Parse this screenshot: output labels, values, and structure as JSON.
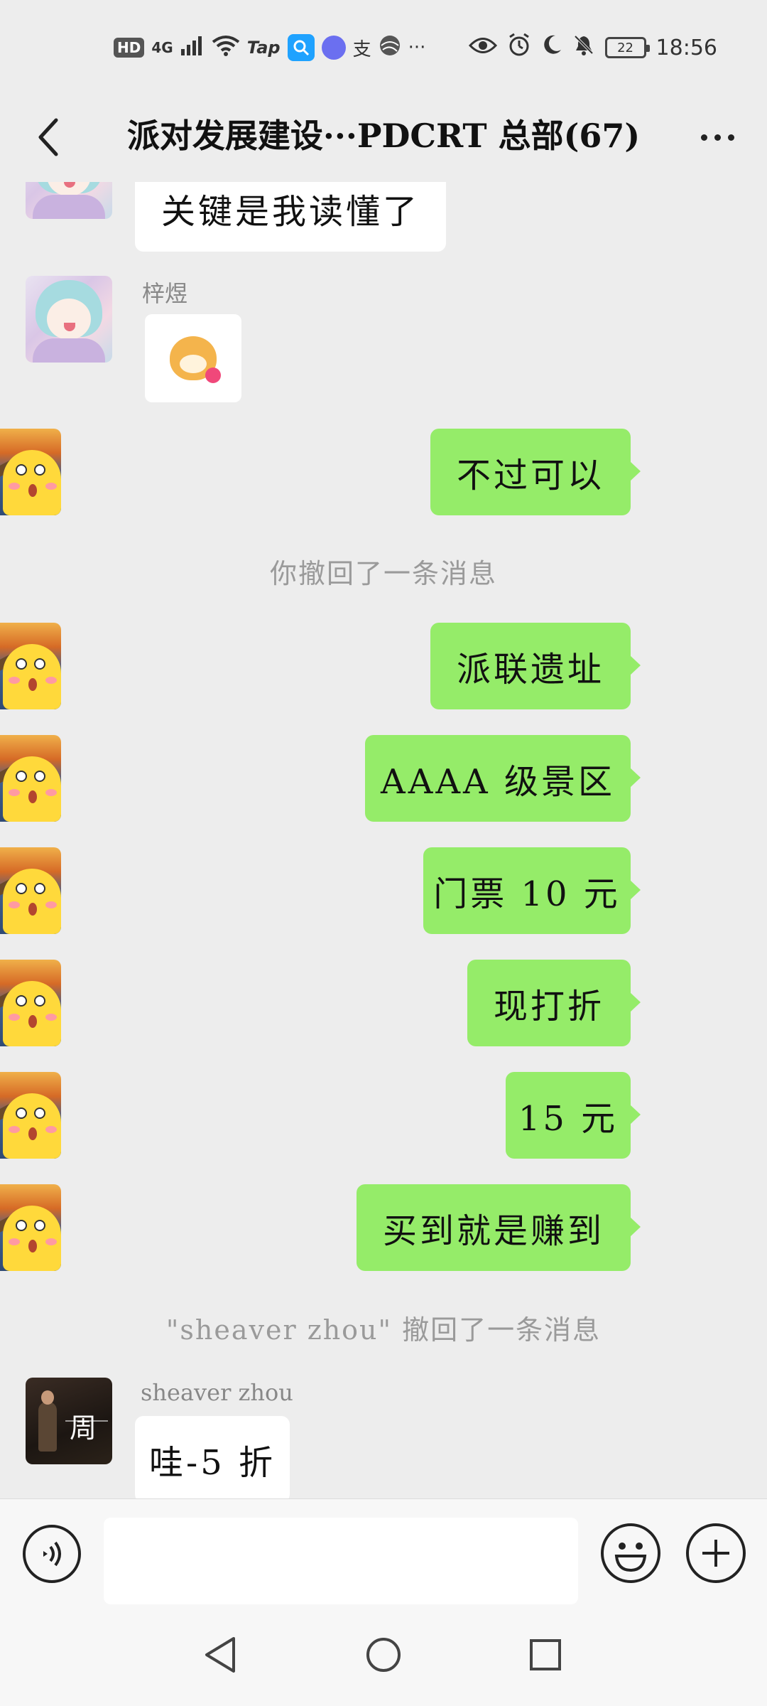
{
  "status_bar": {
    "left_icons": [
      "HD",
      "4G",
      "signal-icon",
      "wifi-icon",
      "Tap",
      "search-app-icon",
      "music-app-icon",
      "支",
      "ball-icon",
      "···"
    ],
    "hd": "HD",
    "network": "4G",
    "tap": "Tap",
    "alipay": "支",
    "more": "···",
    "battery": "22",
    "time": "18:56"
  },
  "header": {
    "title": "派对发展建设···PDCRT 总部(67)"
  },
  "messages": [
    {
      "type": "text",
      "side": "left",
      "text": "关键是我读懂了"
    },
    {
      "type": "sticker",
      "side": "left",
      "sender": "梓煜",
      "sticker": "doge-heart-icon"
    },
    {
      "type": "text",
      "side": "right",
      "text": "不过可以"
    },
    {
      "type": "system",
      "text": "你撤回了一条消息"
    },
    {
      "type": "text",
      "side": "right",
      "text": "派联遗址"
    },
    {
      "type": "text",
      "side": "right",
      "text": "AAAA 级景区"
    },
    {
      "type": "text",
      "side": "right",
      "text": "门票 10 元"
    },
    {
      "type": "text",
      "side": "right",
      "text": "现打折"
    },
    {
      "type": "text",
      "side": "right",
      "text": "15 元"
    },
    {
      "type": "text",
      "side": "right",
      "text": "买到就是赚到"
    },
    {
      "type": "system",
      "text": "\"sheaver zhou\" 撤回了一条消息"
    },
    {
      "type": "text",
      "side": "left",
      "sender": "sheaver zhou",
      "text": "哇-5 折"
    }
  ],
  "avatar_glyph": "周",
  "input": {
    "value": "",
    "placeholder": ""
  },
  "colors": {
    "background": "#ededed",
    "outgoing_bubble": "#95ec69",
    "incoming_bubble": "#ffffff",
    "system_text": "#9a9a9a"
  }
}
